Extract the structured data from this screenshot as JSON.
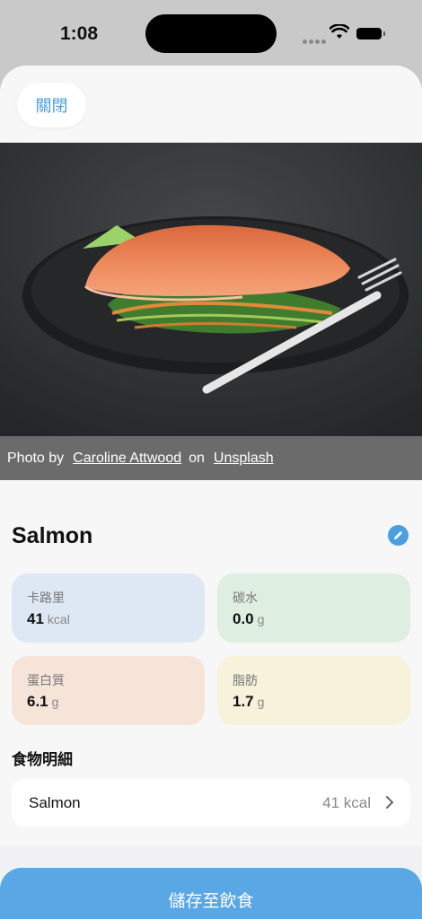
{
  "status_bar": {
    "time": "1:08"
  },
  "header": {
    "close_label": "關閉"
  },
  "photo": {
    "prefix": "Photo by",
    "author": "Caroline Attwood",
    "on": "on",
    "source": "Unsplash"
  },
  "food": {
    "name": "Salmon",
    "nutrients": [
      {
        "label": "卡路里",
        "value": "41",
        "unit": "kcal"
      },
      {
        "label": "碳水",
        "value": "0.0",
        "unit": "g"
      },
      {
        "label": "蛋白質",
        "value": "6.1",
        "unit": "g"
      },
      {
        "label": "脂肪",
        "value": "1.7",
        "unit": "g"
      }
    ]
  },
  "details": {
    "title": "食物明細",
    "items": [
      {
        "name": "Salmon",
        "kcal": "41 kcal"
      }
    ]
  },
  "footer": {
    "save_label": "儲存至飲食"
  },
  "colors": {
    "accent": "#4a9fe0",
    "save_button": "#5aa7e6"
  }
}
